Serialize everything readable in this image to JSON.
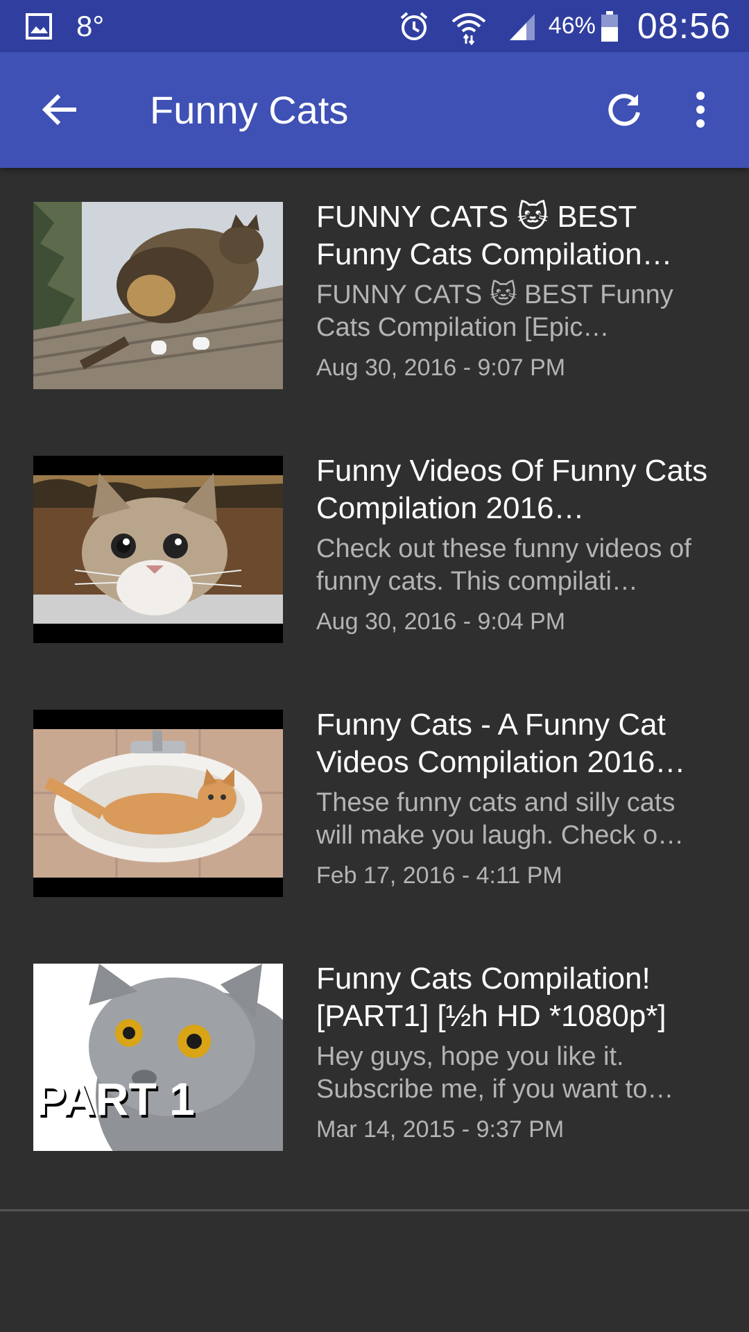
{
  "status_bar": {
    "temperature": "8°",
    "battery_percent": "46%",
    "time": "08:56",
    "icons": [
      "gallery-icon",
      "alarm-icon",
      "wifi-icon",
      "signal-icon",
      "battery-icon"
    ]
  },
  "app_bar": {
    "title": "Funny Cats",
    "icons": [
      "back-arrow-icon",
      "refresh-icon",
      "more-vert-icon"
    ],
    "color": "#3f51b5",
    "status_color": "#303f9f"
  },
  "videos": [
    {
      "title": "FUNNY CATS 🐱 BEST Funny Cats Compilation…",
      "description": "FUNNY CATS 🐱 BEST Funny Cats Compilation [Epic…",
      "date": "Aug 30, 2016 - 9:07 PM",
      "thumbnail": "cat-on-fence-thumbnail"
    },
    {
      "title": "Funny Videos Of Funny Cats Compilation 2016…",
      "description": "Check out these funny videos of funny cats. This compilati…",
      "date": "Aug 30, 2016 - 9:04 PM",
      "thumbnail": "surprised-kitten-thumbnail"
    },
    {
      "title": "Funny Cats - A Funny Cat Videos Compilation 2016…",
      "description": "These funny cats and silly cats will make you laugh. Check o…",
      "date": "Feb 17, 2016 - 4:11 PM",
      "thumbnail": "cat-in-sink-thumbnail"
    },
    {
      "title": "Funny Cats Compilation! [PART1] [½h HD *1080p*]",
      "description": "Hey guys, hope you like it. Subscribe me, if you want to…",
      "date": "Mar 14, 2015 - 9:37 PM",
      "thumbnail": "grey-cat-part1-thumbnail",
      "thumbnail_text": "PART 1"
    }
  ]
}
